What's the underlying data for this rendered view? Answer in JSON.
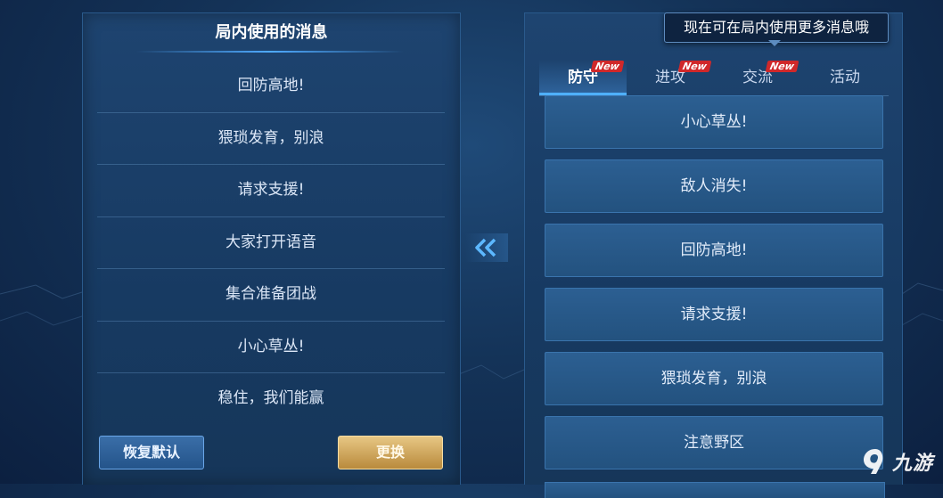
{
  "left_panel": {
    "title": "局内使用的消息",
    "messages": [
      "回防高地!",
      "猥琐发育，别浪",
      "请求支援!",
      "大家打开语音",
      "集合准备团战",
      "小心草丛!",
      "稳住，我们能赢"
    ],
    "reset_label": "恢复默认",
    "change_label": "更换"
  },
  "right_panel": {
    "tooltip": "现在可在局内使用更多消息哦",
    "tabs": [
      {
        "label": "防守",
        "badge": "New",
        "active": true
      },
      {
        "label": "进攻",
        "badge": "New",
        "active": false
      },
      {
        "label": "交流",
        "badge": "New",
        "active": false
      },
      {
        "label": "活动",
        "badge": "",
        "active": false
      }
    ],
    "options": [
      "小心草丛!",
      "敌人消失!",
      "回防高地!",
      "请求支援!",
      "猥琐发育，别浪",
      "注意野区"
    ]
  },
  "icons": {
    "swap": "double-chevron-left-icon"
  },
  "colors": {
    "accent_blue": "#4fb0ff",
    "gold_button": "#d4a95a",
    "new_badge": "#d0282a"
  },
  "watermark": {
    "text": "九游"
  }
}
